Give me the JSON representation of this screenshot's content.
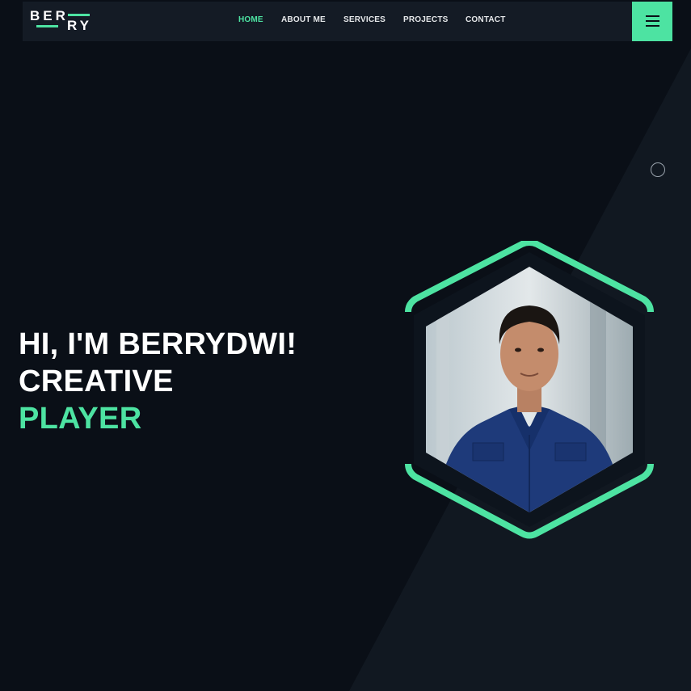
{
  "logo": {
    "line1": "BER",
    "line2": "RY"
  },
  "nav": {
    "items": [
      {
        "label": "HOME",
        "active": true
      },
      {
        "label": "ABOUT ME",
        "active": false
      },
      {
        "label": "SERVICES",
        "active": false
      },
      {
        "label": "PROJECTS",
        "active": false
      },
      {
        "label": "CONTACT",
        "active": false
      }
    ],
    "menu_icon": "hamburger-menu-icon"
  },
  "hero": {
    "greeting": "HI, I'M BERRYDWI!",
    "line2": "CREATIVE",
    "highlight": "PLAYER"
  },
  "colors": {
    "accent": "#4de3a2",
    "background": "#0a0f17",
    "navbar": "#141b25",
    "shirt": "#1e3a7a"
  }
}
